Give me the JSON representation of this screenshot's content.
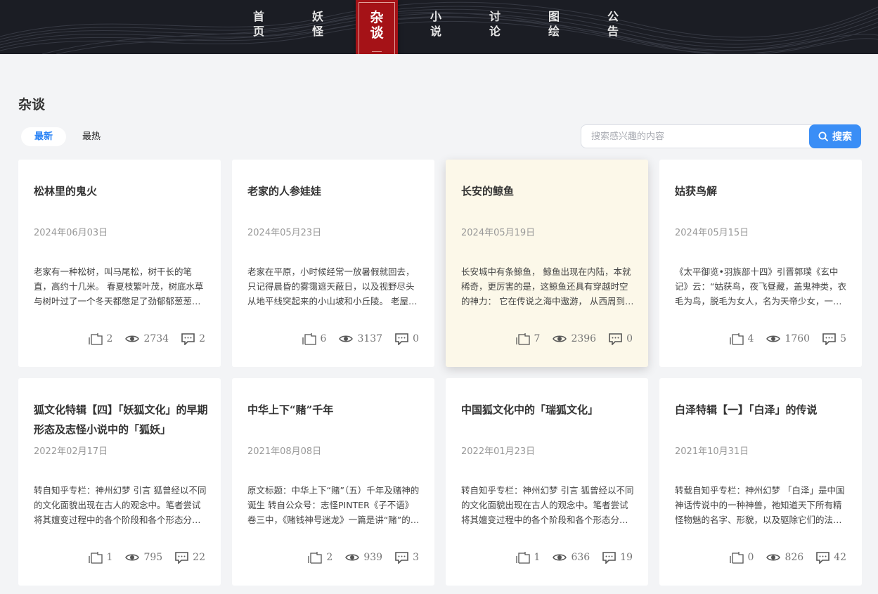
{
  "nav": {
    "items": [
      {
        "label_line1": "首",
        "label_line2": "页"
      },
      {
        "label_line1": "妖",
        "label_line2": "怪"
      },
      {
        "label_line1": "杂",
        "label_line2": "谈"
      },
      {
        "label_line1": "小",
        "label_line2": "说"
      },
      {
        "label_line1": "讨",
        "label_line2": "论"
      },
      {
        "label_line1": "图",
        "label_line2": "绘"
      },
      {
        "label_line1": "公",
        "label_line2": "告"
      }
    ],
    "active_index": 2
  },
  "page": {
    "title": "杂谈"
  },
  "tabs": {
    "latest": "最新",
    "hot": "最热",
    "active": "latest"
  },
  "search": {
    "placeholder": "搜索感兴趣的内容",
    "button_label": "搜索"
  },
  "colors": {
    "accent": "#2a83f5",
    "nav_active": "#a51217",
    "header_bg": "#1b1d24",
    "hover_card": "#fcf8e9"
  },
  "cards": [
    {
      "title": "松林里的鬼火",
      "date": "2024年06月03日",
      "excerpt": "老家有一种松树，叫马尾松，树干长的笔直，高约十几米。 春夏枝繁叶茂，树底水草与树叶过了一个冬天都憋足了劲郁郁葱葱。秋冬树叶掉落，给大地铺上一层厚厚的地毯。",
      "likes": "2",
      "views": "2734",
      "comments": "2"
    },
    {
      "title": "老家的人参娃娃",
      "date": "2024年05月23日",
      "excerpt": "老家在平原，小时候经常一放暑假就回去，只记得晨昏的雾霭遮天蔽日，以及视野尽头从地平线突起来的小山坡和小丘陵。 老屋后面是一片树林，树林再往后是一片田地。",
      "likes": "6",
      "views": "3137",
      "comments": "0"
    },
    {
      "title": "长安的鲸鱼",
      "date": "2024年05月19日",
      "excerpt": "长安城中有条鲸鱼， 鲸鱼出现在内陆，本就稀奇，更厉害的是，这鲸鱼还具有穿越时空的神力： 它在传说之海中遨游， 从西周到西汉，从白鹿原到昆明池。",
      "likes": "7",
      "views": "2396",
      "comments": "0"
    },
    {
      "title": "姑获鸟解",
      "date": "2024年05月15日",
      "excerpt": "《太平御览•羽族部十四》引晋郭璞《玄中记》云：“姑获鸟，夜飞昼藏，盖鬼神类，衣毛为鸟，脱毛为女人，名为天帝少女，一名夜行游女，一名钓星鬼。”",
      "likes": "4",
      "views": "1760",
      "comments": "5"
    },
    {
      "title": "狐文化特辑【四】「妖狐文化」的早期形态及志怪小说中的「狐妖」",
      "date": "2022年02月17日",
      "excerpt": "转自知乎专栏：神州幻梦 引言 狐曾经以不同的文化面貌出现在古人的观念中。笔者尝试将其嬗变过程中的各个阶段和各个形态分别定类为「凡狐」「妖狐」「瑞狐」。",
      "likes": "1",
      "views": "795",
      "comments": "22"
    },
    {
      "title": "中华上下“赌”千年",
      "date": "2021年08月08日",
      "excerpt": "原文标题：中华上下“赌”（五）千年及赌神的诞生 转自公众号：志怪PINTER《子不语》卷三中，《赌钱神号迷龙》一篇是讲“赌”的。既说人世间的“赌”，也说鬼神。",
      "likes": "2",
      "views": "939",
      "comments": "3"
    },
    {
      "title": "中国狐文化中的「瑞狐文化」",
      "date": "2022年01月23日",
      "excerpt": "转自知乎专栏：神州幻梦 引言 狐曾经以不同的文化面貌出现在古人的观念中。笔者尝试将其嬗变过程中的各个阶段和各个形态分别定类为「凡狐」「妖狐」「瑞狐」。",
      "likes": "1",
      "views": "636",
      "comments": "19"
    },
    {
      "title": "白泽特辑【一】「白泽」的传说",
      "date": "2021年10月31日",
      "excerpt": "转载自知乎专栏：神州幻梦 「白泽」是中国神话传说中的一种神兽，祂知道天下所有精怪物魅的名字、形貌，以及驱除它们的法术，而且还具有十分强烈的瑞兽意味。",
      "likes": "0",
      "views": "826",
      "comments": "42"
    }
  ]
}
